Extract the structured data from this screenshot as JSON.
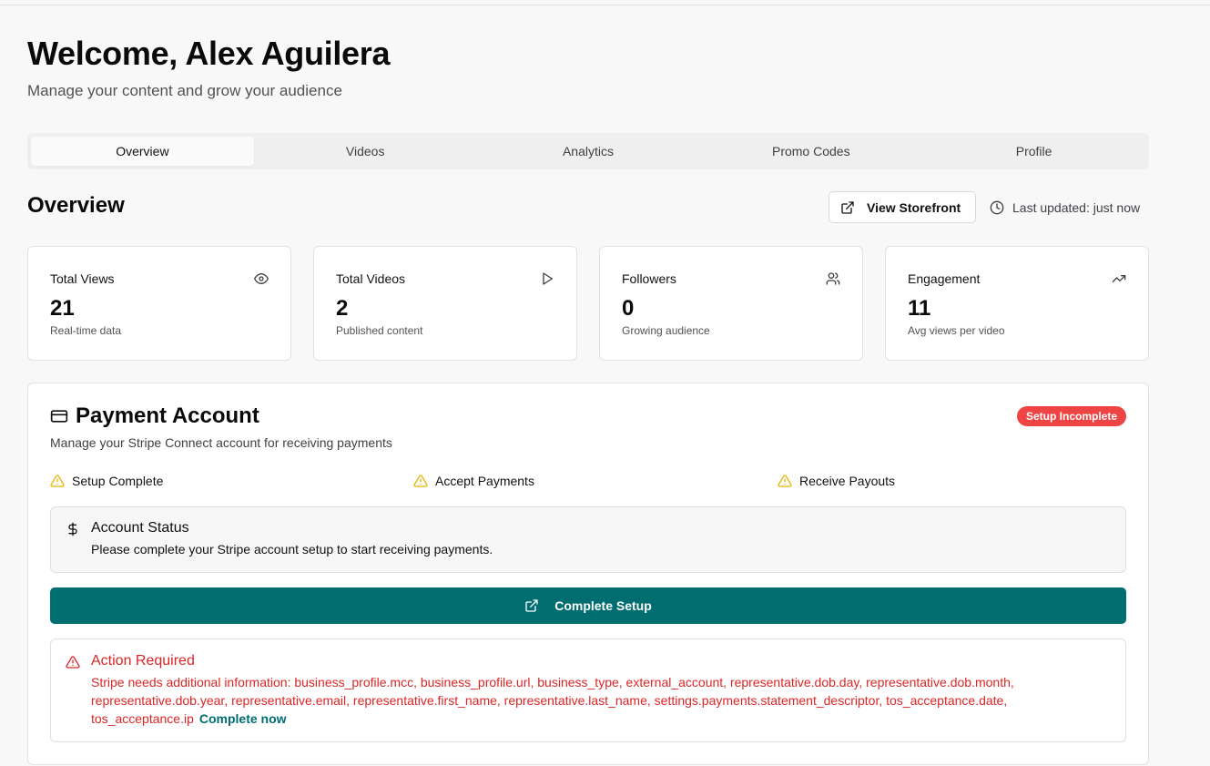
{
  "header": {
    "welcome": "Welcome, Alex Aguilera",
    "subtitle": "Manage your content and grow your audience"
  },
  "tabs": [
    {
      "label": "Overview",
      "active": true
    },
    {
      "label": "Videos",
      "active": false
    },
    {
      "label": "Analytics",
      "active": false
    },
    {
      "label": "Promo Codes",
      "active": false
    },
    {
      "label": "Profile",
      "active": false
    }
  ],
  "overview": {
    "title": "Overview",
    "storefront_label": "View Storefront",
    "storefront_icon": "external-link-icon",
    "last_updated": "Last updated: just now",
    "last_updated_icon": "clock-icon"
  },
  "stats": [
    {
      "label": "Total Views",
      "value": "21",
      "desc": "Real-time data",
      "icon": "eye-icon"
    },
    {
      "label": "Total Videos",
      "value": "2",
      "desc": "Published content",
      "icon": "play-icon"
    },
    {
      "label": "Followers",
      "value": "0",
      "desc": "Growing audience",
      "icon": "users-icon"
    },
    {
      "label": "Engagement",
      "value": "11",
      "desc": "Avg views per video",
      "icon": "trending-up-icon"
    }
  ],
  "payment": {
    "title": "Payment Account",
    "title_icon": "credit-card-icon",
    "badge": "Setup Incomplete",
    "description": "Manage your Stripe Connect account for receiving payments",
    "checks": [
      {
        "label": "Setup Complete",
        "icon": "warning-icon"
      },
      {
        "label": "Accept Payments",
        "icon": "warning-icon"
      },
      {
        "label": "Receive Payouts",
        "icon": "warning-icon"
      }
    ],
    "status": {
      "title": "Account Status",
      "text": "Please complete your Stripe account setup to start receiving payments.",
      "icon": "dollar-icon"
    },
    "setup_button": "Complete Setup",
    "action": {
      "title": "Action Required",
      "text": "Stripe needs additional information: business_profile.mcc, business_profile.url, business_type, external_account, representative.dob.day, representative.dob.month, representative.dob.year, representative.email, representative.first_name, representative.last_name, settings.payments.statement_descriptor, tos_acceptance.date, tos_acceptance.ip",
      "link": "Complete now",
      "icon": "alert-triangle-icon"
    }
  },
  "colors": {
    "accent": "#006d71",
    "danger": "#dc2626",
    "badge": "#ef4444",
    "warning": "#eab308",
    "page_bg": "#f8f8f8"
  }
}
